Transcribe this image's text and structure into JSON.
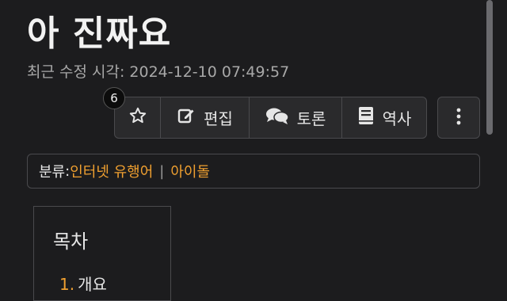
{
  "page": {
    "title": "아 진짜요",
    "last_modified": "최근 수정 시각: 2024-12-10 07:49:57"
  },
  "toolbar": {
    "star_count": "6",
    "edit_label": "편집",
    "discuss_label": "토론",
    "history_label": "역사",
    "icons": [
      "star-icon",
      "edit-icon",
      "discuss-icon",
      "history-icon",
      "more-vertical-icon"
    ]
  },
  "category": {
    "label": "분류",
    "links": [
      "인터넷 유행어",
      "아이돌"
    ]
  },
  "toc": {
    "title": "목차",
    "items": [
      {
        "number": "1.",
        "text": "개요"
      }
    ]
  },
  "colors": {
    "background": "#1c1c1e",
    "link": "#f0a030",
    "border": "#4a4a4d"
  }
}
